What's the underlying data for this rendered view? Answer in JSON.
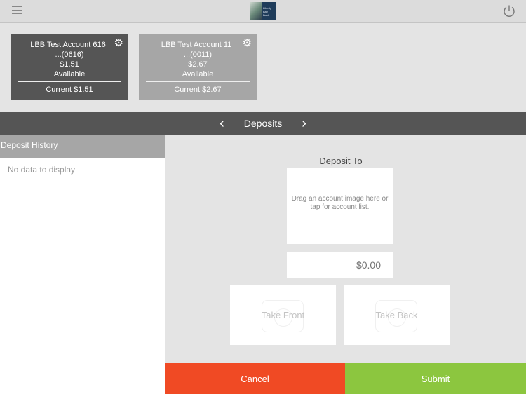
{
  "header": {
    "logo_text": "Liberty Bay Bank"
  },
  "accounts": [
    {
      "name": "LBB Test Account 616",
      "number": "...(0616)",
      "balance": "$1.51",
      "balance_label": "Available",
      "current": "Current $1.51"
    },
    {
      "name": "LBB Test Account 11",
      "number": "...(0011)",
      "balance": "$2.67",
      "balance_label": "Available",
      "current": "Current $2.67"
    }
  ],
  "nav": {
    "title": "Deposits"
  },
  "history": {
    "title": "Deposit History",
    "empty": "No data to display"
  },
  "deposit": {
    "to_label": "Deposit To",
    "drop_hint": "Drag an account image here or tap for account list.",
    "amount_placeholder": "$0.00",
    "front": "Take Front",
    "back": "Take Back"
  },
  "actions": {
    "cancel": "Cancel",
    "submit": "Submit"
  },
  "colors": {
    "cancel": "#f04a24",
    "submit": "#8cc63f",
    "nav": "#555555"
  }
}
